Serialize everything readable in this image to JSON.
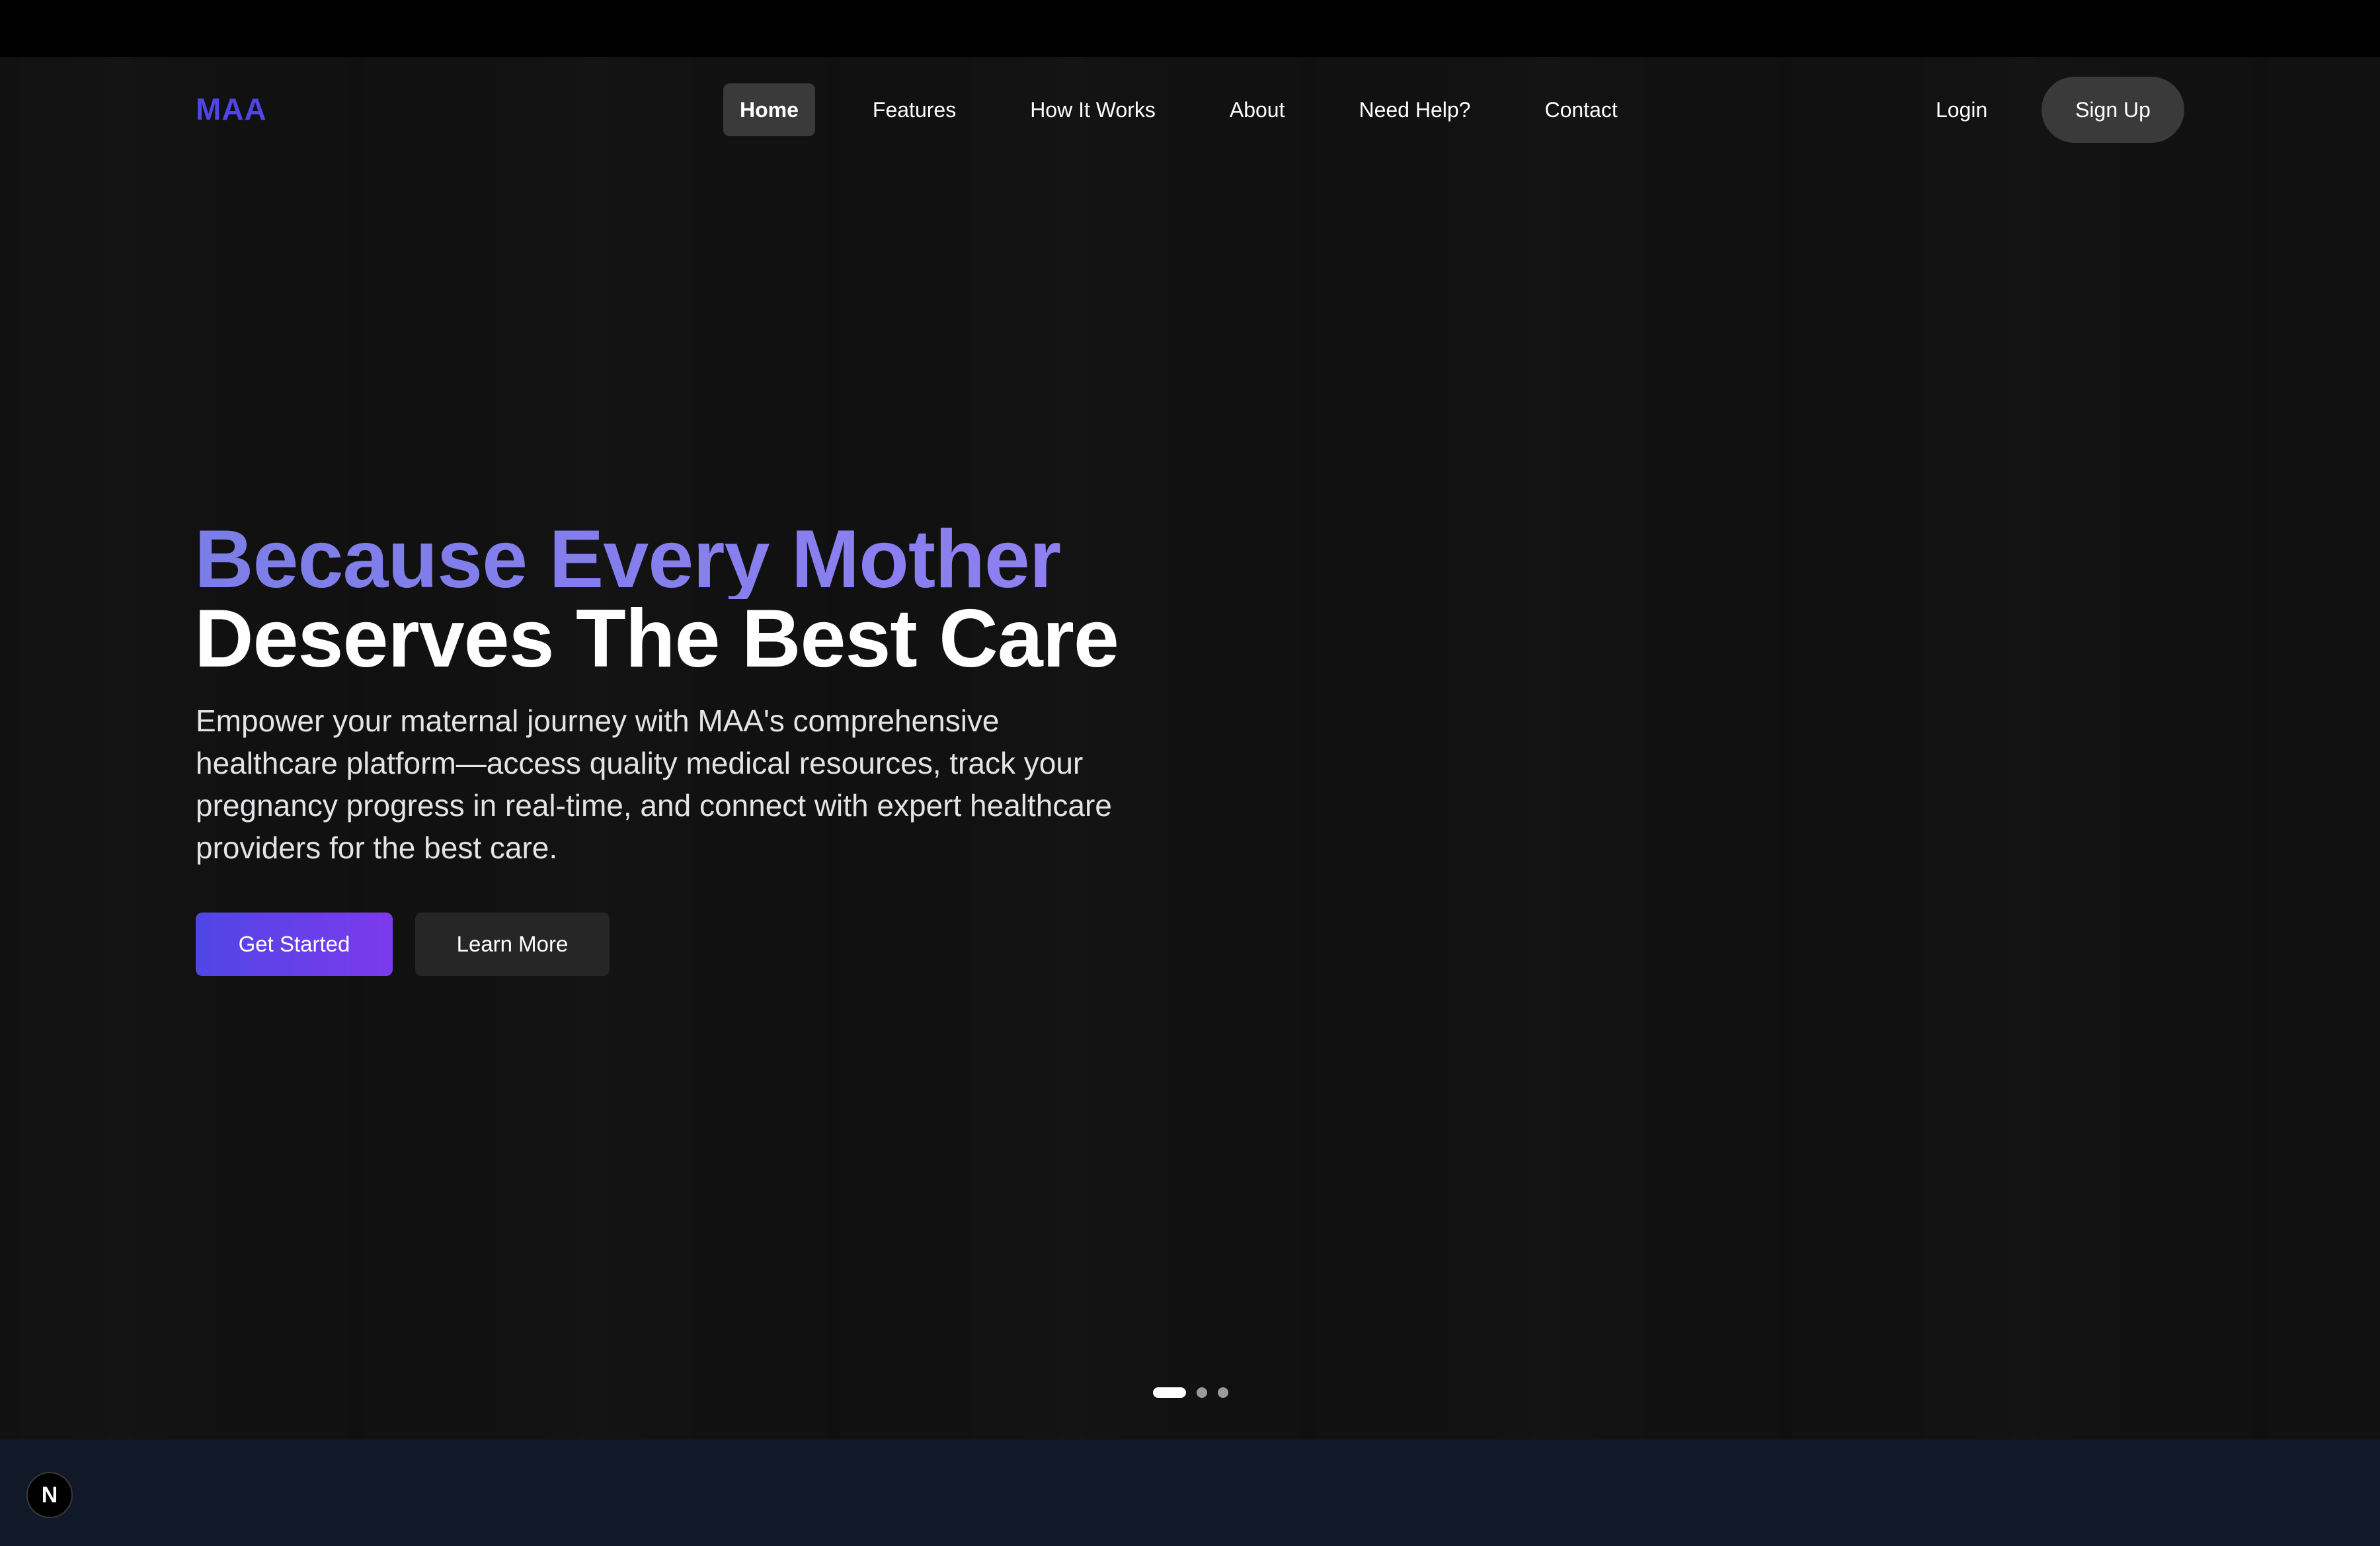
{
  "brand": {
    "logo": "MAA",
    "accent": "#4f46e5",
    "accent_end": "#7c3aed",
    "headline_gradient": "#8b7ff0"
  },
  "nav": {
    "items": [
      {
        "label": "Home",
        "active": true
      },
      {
        "label": "Features",
        "active": false
      },
      {
        "label": "How It Works",
        "active": false
      },
      {
        "label": "About",
        "active": false
      },
      {
        "label": "Need Help?",
        "active": false
      },
      {
        "label": "Contact",
        "active": false
      }
    ],
    "login": "Login",
    "signup": "Sign Up"
  },
  "hero": {
    "headline_line1": "Because Every Mother",
    "headline_line2": "Deserves The Best Care",
    "subtext": "Empower your maternal journey with MAA's comprehensive healthcare platform—access quality medical resources, track your pregnancy progress in real-time, and connect with expert healthcare providers for the best care.",
    "cta_primary": "Get Started",
    "cta_secondary": "Learn More",
    "carousel": {
      "slides": 3,
      "active_index": 0
    }
  },
  "dev_badge": {
    "label": "N",
    "icon": "nextjs-icon"
  }
}
